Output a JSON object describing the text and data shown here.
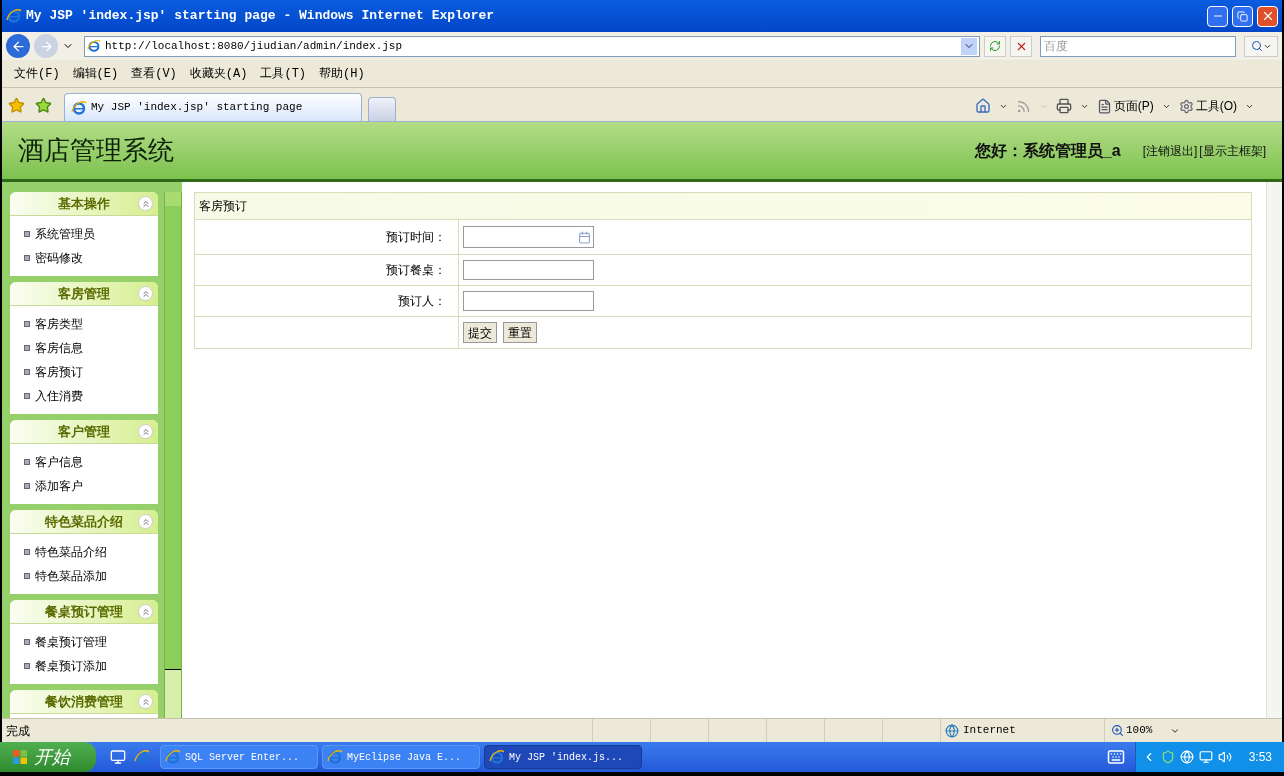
{
  "window": {
    "title": "My JSP 'index.jsp' starting page - Windows Internet Explorer"
  },
  "address_bar": {
    "url": "http://localhost:8080/jiudian/admin/index.jsp"
  },
  "search": {
    "placeholder": "百度"
  },
  "menu": [
    "文件(F)",
    "编辑(E)",
    "查看(V)",
    "收藏夹(A)",
    "工具(T)",
    "帮助(H)"
  ],
  "tab": {
    "title": "My JSP 'index.jsp' starting page"
  },
  "command_bar": [
    "页面(P)",
    "工具(O)"
  ],
  "page": {
    "title": "酒店管理系统",
    "greeting": "您好：系统管理员_a",
    "links": [
      "[注销退出]",
      "[显示主框架]"
    ]
  },
  "sidebar": {
    "groups": [
      {
        "title": "基本操作",
        "expanded": true,
        "items": [
          "系统管理员",
          "密码修改"
        ]
      },
      {
        "title": "客房管理",
        "expanded": true,
        "items": [
          "客房类型",
          "客房信息",
          "客房预订",
          "入住消费"
        ]
      },
      {
        "title": "客户管理",
        "expanded": true,
        "items": [
          "客户信息",
          "添加客户"
        ]
      },
      {
        "title": "特色菜品介绍",
        "expanded": true,
        "items": [
          "特色菜品介绍",
          "特色菜品添加"
        ]
      },
      {
        "title": "餐桌预订管理",
        "expanded": true,
        "items": [
          "餐桌预订管理",
          "餐桌预订添加"
        ]
      },
      {
        "title": "餐饮消费管理",
        "expanded": true
      }
    ]
  },
  "form": {
    "title": "客房预订",
    "fields": [
      {
        "label": "预订时间：",
        "kind": "date"
      },
      {
        "label": "预订餐桌：",
        "kind": "text"
      },
      {
        "label": "预订人：",
        "kind": "text"
      }
    ],
    "buttons": [
      "提交",
      "重置"
    ]
  },
  "status_bar": {
    "text": "完成",
    "zone": "Internet",
    "zoom": "100%"
  },
  "taskbar": {
    "start": "开始",
    "tasks": [
      {
        "label": "SQL Server Enter...",
        "selected": false
      },
      {
        "label": "MyEclipse Java E...",
        "selected": false
      },
      {
        "label": "My JSP 'index.js...",
        "selected": true
      }
    ],
    "clock": "3:53"
  }
}
